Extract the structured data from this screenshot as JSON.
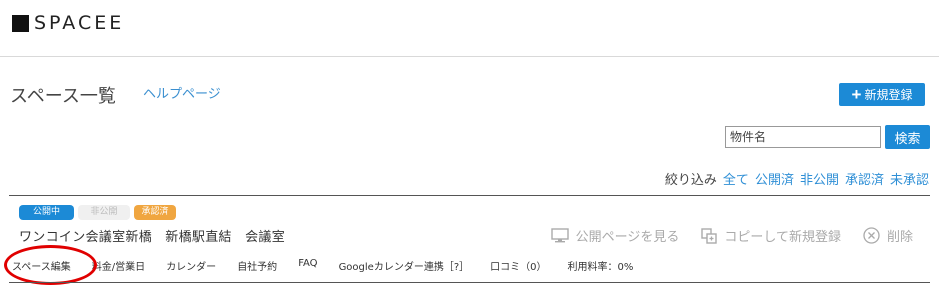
{
  "header": {
    "logo_text": "SPACEE"
  },
  "page": {
    "title": "スペース一覧",
    "help_link": "ヘルプページ",
    "new_button": "新規登録"
  },
  "search": {
    "placeholder": "物件名",
    "button": "検索"
  },
  "filter": {
    "label": "絞り込み",
    "options": [
      "全て",
      "公開済",
      "非公開",
      "承認済",
      "未承認"
    ]
  },
  "space": {
    "badges": {
      "public": "公開中",
      "private": "非公開",
      "approved": "承認済"
    },
    "name": "ワンコイン会議室新橋　新橋駅直結　会議室",
    "actions": {
      "view": "公開ページを見る",
      "copy": "コピーして新規登録",
      "delete": "削除"
    },
    "tabs": [
      "スペース編集",
      "料金/営業日",
      "カレンダー",
      "自社予約",
      "FAQ",
      "Googleカレンダー連携［?］",
      "口コミ（0）",
      "利用料率：0%"
    ]
  },
  "colors": {
    "accent": "#1c8ad6",
    "approved_badge": "#f0a640",
    "highlight_circle": "#e00000"
  }
}
